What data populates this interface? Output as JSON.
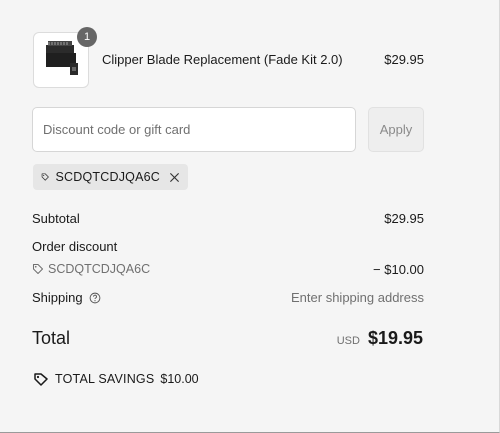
{
  "product": {
    "name": "Clipper Blade Replacement (Fade Kit 2.0)",
    "price": "$29.95",
    "quantity": "1"
  },
  "discount": {
    "placeholder": "Discount code or gift card",
    "value": "",
    "apply_label": "Apply",
    "applied_code": "SCDQTCDJQA6C"
  },
  "summary": {
    "subtotal_label": "Subtotal",
    "subtotal_value": "$29.95",
    "order_discount_label": "Order discount",
    "discount_code": "SCDQTCDJQA6C",
    "discount_amount": "− $10.00",
    "shipping_label": "Shipping",
    "shipping_value": "Enter shipping address",
    "total_label": "Total",
    "currency": "USD",
    "total_value": "$19.95",
    "savings_label": "TOTAL SAVINGS",
    "savings_value": "$10.00"
  },
  "icons": {
    "tag": "tag-icon",
    "close": "close-icon",
    "help": "question-circle-icon",
    "savings": "savings-tag-icon"
  }
}
